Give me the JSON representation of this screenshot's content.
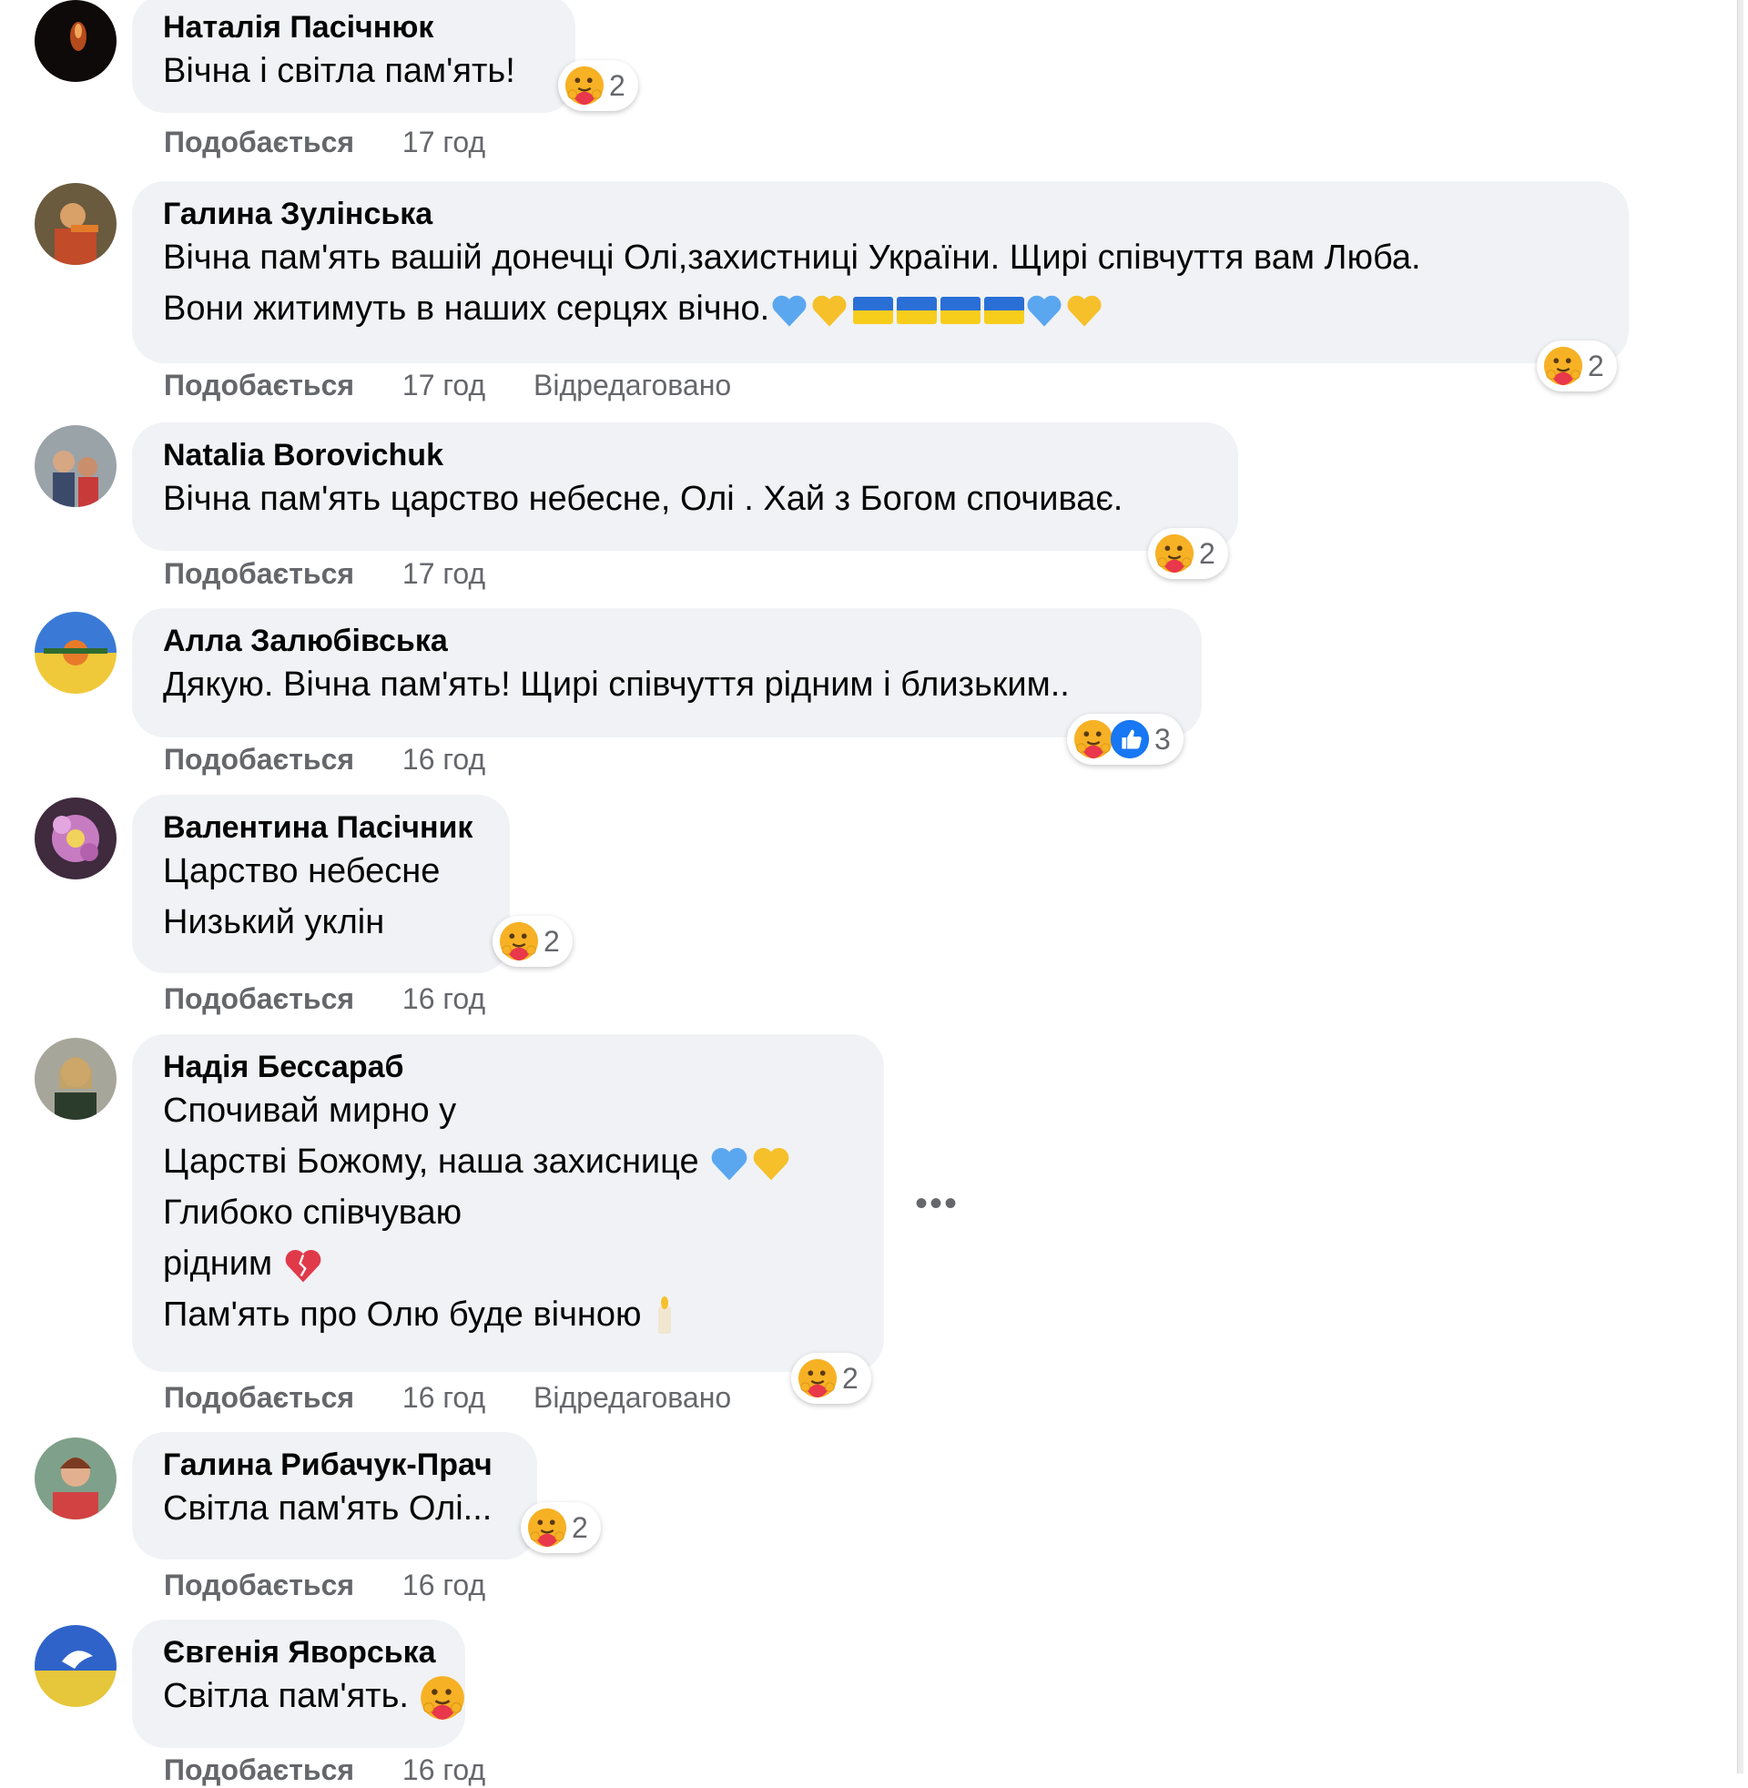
{
  "comments": [
    {
      "author": "Наталія Пасічнюк",
      "lines": [
        "Вічна і світла пам'ять!"
      ],
      "reactions": {
        "count": "2"
      },
      "like": "Подобається",
      "time": "17 год"
    },
    {
      "author": "Галина Зулінська",
      "lines": [
        "Вічна пам'ять вашій донечці Олі,захистниці України. Щирі співчуття вам Люба.",
        "Вони житимуть в наших серцях вічно."
      ],
      "reactions": {
        "count": "2"
      },
      "like": "Подобається",
      "time": "17 год",
      "edited": "Відредаговано"
    },
    {
      "author": "Natalia Borovichuk",
      "lines": [
        "Вічна пам'ять царство небесне, Олі . Хай з Богом спочиває."
      ],
      "reactions": {
        "count": "2"
      },
      "like": "Подобається",
      "time": "17 год"
    },
    {
      "author": "Алла Залюбівська",
      "lines": [
        "Дякую. Вічна пам'ять! Щирі співчуття рідним і близьким.."
      ],
      "reactions": {
        "count": "3"
      },
      "like": "Подобається",
      "time": "16 год"
    },
    {
      "author": "Валентина Пасічник",
      "lines": [
        "Царство небесне",
        "Низький уклін"
      ],
      "reactions": {
        "count": "2"
      },
      "like": "Подобається",
      "time": "16 год"
    },
    {
      "author": "Надія Бессараб",
      "lines": [
        "Спочивай мирно у",
        "Царстві Божому, наша захиснице",
        "Глибоко співчуваю",
        "рідним",
        "Пам'ять про Олю буде вічною"
      ],
      "reactions": {
        "count": "2"
      },
      "like": "Подобається",
      "time": "16 год",
      "edited": "Відредаговано",
      "more": "•••"
    },
    {
      "author": "Галина Рибачук-Прач",
      "lines": [
        "Світла пам'ять Олі..."
      ],
      "reactions": {
        "count": "2"
      },
      "like": "Подобається",
      "time": "16 год"
    },
    {
      "author": "Євгенія Яворська",
      "lines": [
        "Світла пам'ять."
      ],
      "like": "Подобається",
      "time": "16 год"
    }
  ],
  "colors": {
    "bubble": "#f0f2f5",
    "meta": "#65676b",
    "care_face": "#f7b125",
    "care_heart": "#e9374b",
    "like_blue": "#1877f2",
    "heart_blue": "#5aa7f0",
    "heart_yellow": "#f5c02a",
    "flag_blue": "#2a6fd6",
    "flag_yellow": "#f7cd1c"
  },
  "icons": [
    "care-reaction-icon",
    "like-reaction-icon",
    "blue-heart-emoji",
    "yellow-heart-emoji",
    "ukraine-flag-emoji",
    "broken-heart-emoji",
    "candle-emoji"
  ]
}
